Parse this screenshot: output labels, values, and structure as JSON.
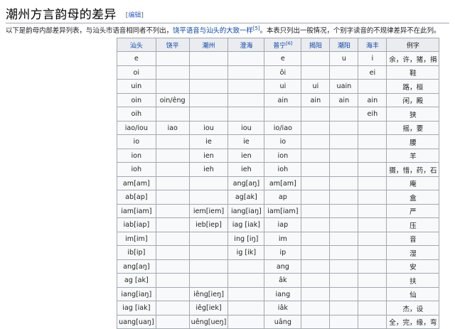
{
  "heading": {
    "title": "潮州方言韵母的差异",
    "edit_open": "[",
    "edit_label": "编辑",
    "edit_close": "]"
  },
  "intro": {
    "before_link": "以下是韵母内部差异列表，与汕头市语音相同者不列出，",
    "link_text": "饶平语音与汕头的大致一样",
    "ref": "[5]",
    "after_link": "。本表只列出一般情况，个别字读音的不规律差异不在此列。"
  },
  "table": {
    "headers": [
      {
        "label": "汕头",
        "sup": "",
        "link": true
      },
      {
        "label": "饶平",
        "sup": "",
        "link": true
      },
      {
        "label": "潮州",
        "sup": "",
        "link": true
      },
      {
        "label": "澄海",
        "sup": "",
        "link": true
      },
      {
        "label": "普宁",
        "sup": "[6]",
        "link": true
      },
      {
        "label": "揭阳",
        "sup": "",
        "link": true
      },
      {
        "label": "潮阳",
        "sup": "",
        "link": true
      },
      {
        "label": "海丰",
        "sup": "",
        "link": true
      },
      {
        "label": "例字",
        "sup": "",
        "link": false
      }
    ],
    "rows": [
      [
        "e",
        "",
        "",
        "",
        "e",
        "",
        "u",
        "i",
        "余，许，猪，捐"
      ],
      [
        "oi",
        "",
        "",
        "",
        "ôi",
        "",
        "",
        "ei",
        "鞋"
      ],
      [
        "uin",
        "",
        "",
        "",
        "ui",
        "ui",
        "uain",
        "",
        "路，桓"
      ],
      [
        "oin",
        "oin/êng",
        "",
        "",
        "ain",
        "ain",
        "ain",
        "ain",
        "闲，殿"
      ],
      [
        "oih",
        "",
        "",
        "",
        "",
        "",
        "",
        "eih",
        "狭"
      ],
      [
        "iao/iou",
        "iao",
        "iou",
        "iou",
        "io/iao",
        "",
        "",
        "",
        "摇，要"
      ],
      [
        "io",
        "",
        "ie",
        "ie",
        "io",
        "",
        "",
        "",
        "腰"
      ],
      [
        "ion",
        "",
        "ien",
        "ien",
        "ion",
        "",
        "",
        "",
        "羊"
      ],
      [
        "ioh",
        "",
        "ieh",
        "ieh",
        "ioh",
        "",
        "",
        "",
        "摄，惜，药，石"
      ],
      [
        "am[am]",
        "",
        "",
        "ang[aŋ]",
        "am[am]",
        "",
        "",
        "",
        "庵"
      ],
      [
        "ab[ap]",
        "",
        "",
        "ag[ak]",
        "ap",
        "",
        "",
        "",
        "盒"
      ],
      [
        "iam[iam]",
        "",
        "iem[iem]",
        "iang[iaŋ]",
        "iam[iam]",
        "",
        "",
        "",
        "严"
      ],
      [
        "iab[iap]",
        "",
        "ieb[iep]",
        "iag [iak]",
        "iap",
        "",
        "",
        "",
        "压"
      ],
      [
        "im[im]",
        "",
        "",
        "ing [iŋ]",
        "im",
        "",
        "",
        "",
        "音"
      ],
      [
        "ib[ip]",
        "",
        "",
        "ig [ik]",
        "ip",
        "",
        "",
        "",
        "湿"
      ],
      [
        "ang[aŋ]",
        "",
        "",
        "",
        "ang",
        "",
        "",
        "",
        "安"
      ],
      [
        "ag [ak]",
        "",
        "",
        "",
        "âk",
        "",
        "",
        "",
        "扶"
      ],
      [
        "iang[iaŋ]",
        "",
        "iêng[ieŋ]",
        "",
        "iang",
        "",
        "",
        "",
        "仙"
      ],
      [
        "iag [iak]",
        "",
        "iêg[iek]",
        "",
        "iâk",
        "",
        "",
        "",
        "杰，设"
      ],
      [
        "uang[uaŋ]",
        "",
        "uêng[ueŋ]",
        "",
        "uâng",
        "",
        "",
        "",
        "全，完，缘，弯"
      ]
    ]
  }
}
